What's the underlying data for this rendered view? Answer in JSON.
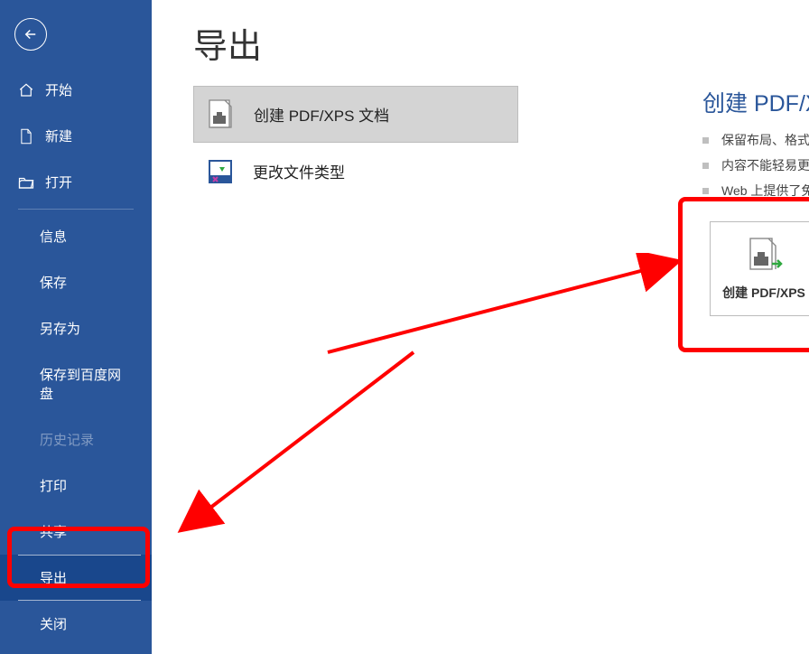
{
  "sidebar": {
    "items": [
      {
        "label": "开始",
        "icon": "home-icon"
      },
      {
        "label": "新建",
        "icon": "new-doc-icon"
      },
      {
        "label": "打开",
        "icon": "open-folder-icon"
      }
    ],
    "secondary": [
      {
        "label": "信息"
      },
      {
        "label": "保存"
      },
      {
        "label": "另存为"
      },
      {
        "label": "保存到百度网盘"
      },
      {
        "label": "历史记录",
        "disabled": true
      },
      {
        "label": "打印"
      },
      {
        "label": "共享"
      },
      {
        "label": "导出",
        "active": true
      },
      {
        "label": "关闭"
      }
    ]
  },
  "page_title": "导出",
  "options": [
    {
      "label": "创建 PDF/XPS 文档",
      "selected": true
    },
    {
      "label": "更改文件类型",
      "selected": false
    }
  ],
  "right": {
    "title": "创建 PDF/XPS 文档",
    "bullets": [
      "保留布局、格式、字体和图像",
      "内容不能轻易更改",
      "Web 上提供了免费查看器"
    ]
  },
  "create_button": {
    "label": "创建 PDF/XPS"
  }
}
